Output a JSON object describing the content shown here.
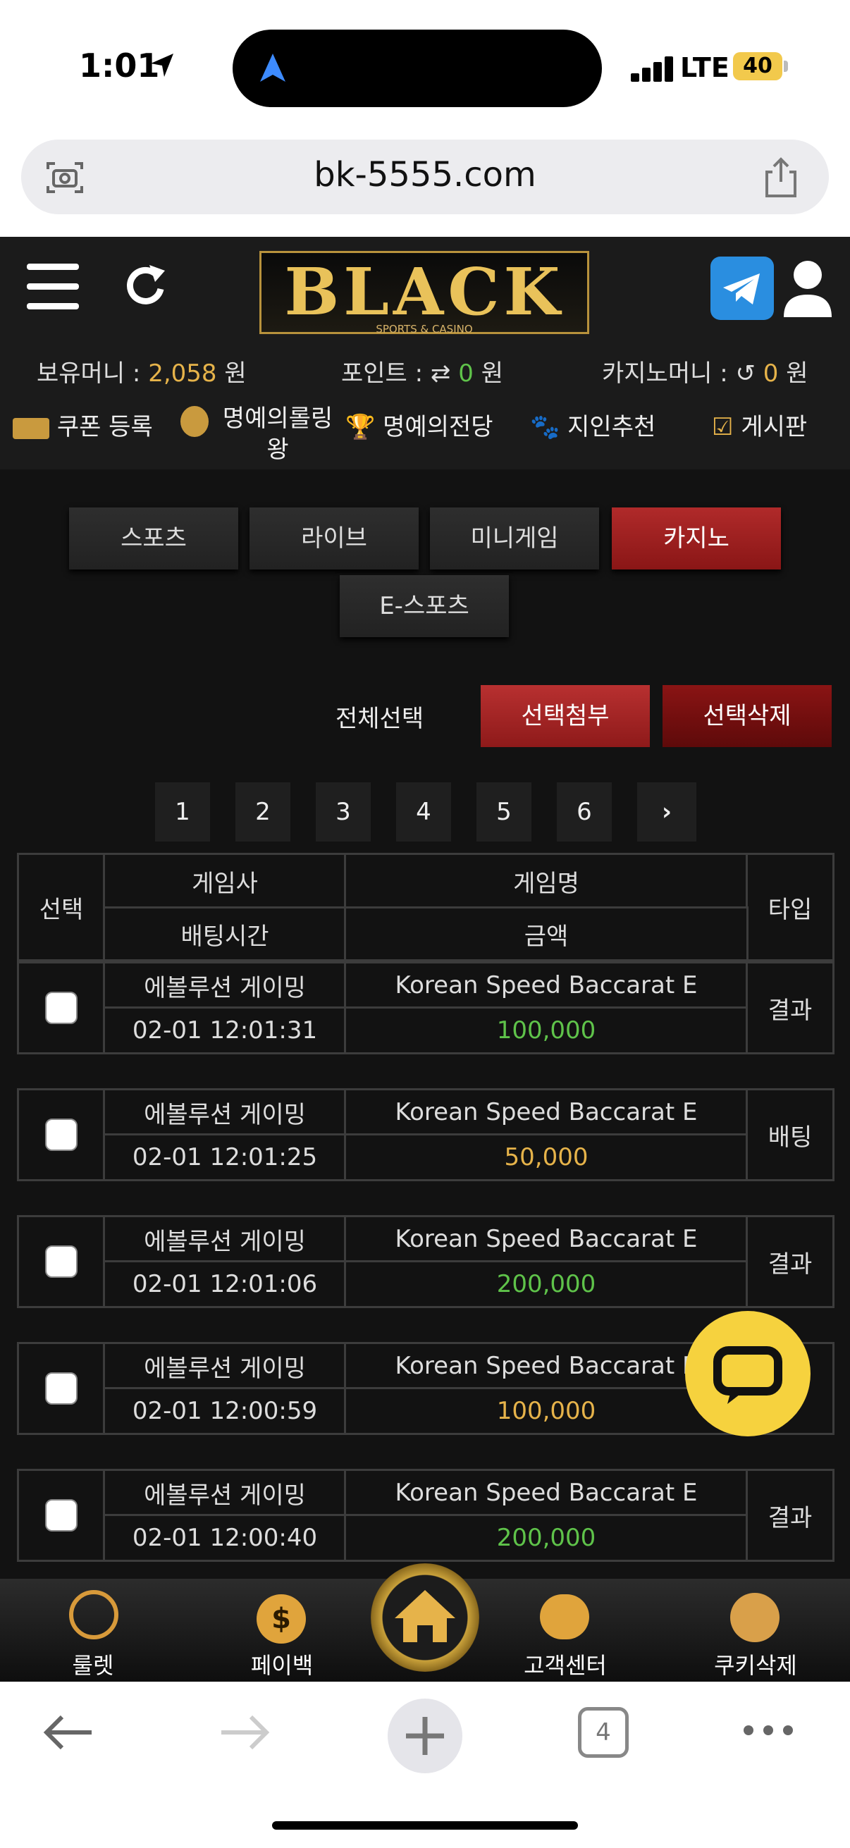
{
  "status_bar": {
    "time": "1:01",
    "network": "LTE",
    "battery": "40"
  },
  "browser": {
    "url": "bk-5555.com",
    "tab_count": "4"
  },
  "logo": {
    "text": "BLACK",
    "subtitle": "SPORTS & CASINO"
  },
  "balances": {
    "holding_label": "보유머니 :",
    "holding_value": "2,058",
    "holding_unit": "원",
    "point_label": "포인트 :",
    "point_value": "0",
    "point_unit": "원",
    "casino_label": "카지노머니 :",
    "casino_value": "0",
    "casino_unit": "원"
  },
  "quick_nav": [
    {
      "label": "쿠폰 등록",
      "icon": "coupon-icon"
    },
    {
      "label": "명예의롤링\n왕",
      "icon": "medal-icon"
    },
    {
      "label": "명예의전당",
      "icon": "trophy-icon"
    },
    {
      "label": "지인추천",
      "icon": "paw-icon"
    },
    {
      "label": "게시판",
      "icon": "board-check-icon"
    }
  ],
  "tabs": [
    {
      "label": "스포츠",
      "active": false
    },
    {
      "label": "라이브",
      "active": false
    },
    {
      "label": "미니게임",
      "active": false
    },
    {
      "label": "카지노",
      "active": true
    },
    {
      "label": "E-스포츠",
      "active": false
    }
  ],
  "actions": {
    "select_all": "전체선택",
    "attach": "선택첨부",
    "delete": "선택삭제"
  },
  "pagination": [
    "1",
    "2",
    "3",
    "4",
    "5",
    "6"
  ],
  "table": {
    "headers": {
      "select": "선택",
      "provider": "게임사",
      "game": "게임명",
      "type": "타입",
      "time": "배팅시간",
      "amount": "금액"
    },
    "rows": [
      {
        "provider": "에볼루션 게이밍",
        "game": "Korean Speed Baccarat E",
        "time": "02-01 12:01:31",
        "amount": "100,000",
        "type": "결과",
        "amount_color": "#5fc34a"
      },
      {
        "provider": "에볼루션 게이밍",
        "game": "Korean Speed Baccarat E",
        "time": "02-01 12:01:25",
        "amount": "50,000",
        "type": "배팅",
        "amount_color": "#e6b34a"
      },
      {
        "provider": "에볼루션 게이밍",
        "game": "Korean Speed Baccarat E",
        "time": "02-01 12:01:06",
        "amount": "200,000",
        "type": "결과",
        "amount_color": "#5fc34a"
      },
      {
        "provider": "에볼루션 게이밍",
        "game": "Korean Speed Baccarat E",
        "time": "02-01 12:00:59",
        "amount": "100,000",
        "type": "",
        "amount_color": "#e6b34a"
      },
      {
        "provider": "에볼루션 게이밍",
        "game": "Korean Speed Baccarat E",
        "time": "02-01 12:00:40",
        "amount": "200,000",
        "type": "결과",
        "amount_color": "#5fc34a"
      }
    ]
  },
  "bottom_nav": [
    {
      "label": "룰렛",
      "icon": "roulette-icon"
    },
    {
      "label": "페이백",
      "icon": "payback-icon"
    },
    {
      "label": "",
      "icon": "home-icon"
    },
    {
      "label": "고객센터",
      "icon": "support-icon"
    },
    {
      "label": "쿠키삭제",
      "icon": "cookie-icon"
    }
  ]
}
